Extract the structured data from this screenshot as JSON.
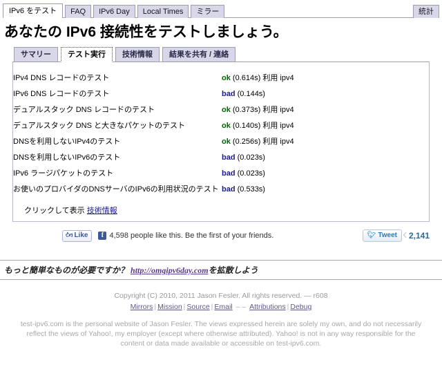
{
  "site": {
    "top_tabs": [
      {
        "label": "IPv6 をテスト",
        "active": true
      },
      {
        "label": "FAQ",
        "active": false
      },
      {
        "label": "IPv6 Day",
        "active": false
      },
      {
        "label": "Local Times",
        "active": false
      },
      {
        "label": "ミラー",
        "active": false
      }
    ],
    "stats_tab": "統計"
  },
  "headline": "あなたの IPv6 接続性をテストしましょう。",
  "sub_tabs": [
    {
      "label": "サマリー",
      "active": false
    },
    {
      "label": "テスト実行",
      "active": true
    },
    {
      "label": "技術情報",
      "active": false
    },
    {
      "label": "結果を共有 / 連絡",
      "active": false
    }
  ],
  "results": {
    "rows": [
      {
        "label": "IPv4 DNS レコードのテスト",
        "status": "ok",
        "status_class": "ok",
        "time": "(0.614s)",
        "using": "利用 ipv4"
      },
      {
        "label": "IPv6 DNS レコードのテスト",
        "status": "bad",
        "status_class": "bad",
        "time": "(0.144s)",
        "using": ""
      },
      {
        "label": "デュアルスタック DNS レコードのテスト",
        "status": "ok",
        "status_class": "ok",
        "time": "(0.373s)",
        "using": "利用 ipv4"
      },
      {
        "label": "デュアルスタック DNS と大きなパケットのテスト",
        "status": "ok",
        "status_class": "ok",
        "time": "(0.140s)",
        "using": "利用 ipv4"
      },
      {
        "label": "DNSを利用しないIPv4のテスト",
        "status": "ok",
        "status_class": "ok",
        "time": "(0.256s)",
        "using": "利用 ipv4"
      },
      {
        "label": "DNSを利用しないIPv6のテスト",
        "status": "bad",
        "status_class": "bad",
        "time": "(0.023s)",
        "using": ""
      },
      {
        "label": "IPv6 ラージパケットのテスト",
        "status": "bad",
        "status_class": "bad",
        "time": "(0.023s)",
        "using": ""
      },
      {
        "label": "お使いのプロバイダのDNSサーバのIPv6の利用状況のテスト",
        "status": "bad",
        "status_class": "bad",
        "time": "(0.533s)",
        "using": ""
      }
    ],
    "click_prefix": "クリックして表示",
    "click_link": "技術情報"
  },
  "social": {
    "like_label": "Like",
    "like_icon": "thumbs-up-icon",
    "facebook_badge": "f",
    "like_text": "4,598 people like this. Be the first of your friends.",
    "tweet_label": "Tweet",
    "tweet_icon": "twitter-bird-icon",
    "tweet_count": "2,141"
  },
  "promo": {
    "prefix": "もっと簡単なものが必要ですか？ ",
    "link": "http://omgipv6day.com",
    "suffix": "を拡散しよう"
  },
  "footer": {
    "copyright": "Copyright (C) 2010, 2011  Jason Fesler. All rights reserved. — r608",
    "links": [
      {
        "label": "Mirrors"
      },
      {
        "label": "Mission"
      },
      {
        "label": "Source"
      },
      {
        "label": "Email"
      },
      {
        "label": "Attributions"
      },
      {
        "label": "Debug"
      }
    ],
    "email_dashes": "– –",
    "disclaimer": "test-ipv6.com is the personal website of Jason Fesler. The views expressed herein are solely my own, and do not necessarily reflect the views of Yahoo!, my employer (except where otherwise attributed). Yahoo! is not in any way responsible for the content or data made available or accessible on test-ipv6.com."
  },
  "colors": {
    "ok": "#006400",
    "bad": "#1a1a8c",
    "tab_bg": "#d7d7e8",
    "link": "#1a1a8c"
  }
}
